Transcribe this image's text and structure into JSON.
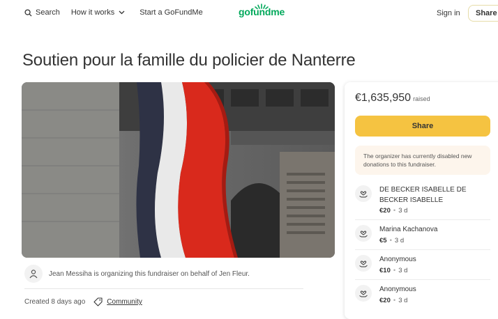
{
  "nav": {
    "search": "Search",
    "how_it_works": "How it works",
    "start": "Start a GoFundMe",
    "logo": "gofundme",
    "sign_in": "Sign in",
    "share": "Share"
  },
  "title": "Soutien pour la famille du policier de Nanterre",
  "organizer": {
    "text": "Jean Messiha is organizing this fundraiser on behalf of Jen Fleur."
  },
  "meta": {
    "created": "Created 8 days ago",
    "category": "Community"
  },
  "panel": {
    "amount": "€1,635,950",
    "raised": "raised",
    "share": "Share",
    "notice": "The organizer has currently disabled new donations to this fundraiser."
  },
  "donations": [
    {
      "name": "DE BECKER ISABELLE DE BECKER ISABELLE",
      "amount": "€20",
      "time": "3 d"
    },
    {
      "name": "Marina Kachanova",
      "amount": "€5",
      "time": "3 d"
    },
    {
      "name": "Anonymous",
      "amount": "€10",
      "time": "3 d"
    },
    {
      "name": "Anonymous",
      "amount": "€20",
      "time": "3 d"
    }
  ],
  "colors": {
    "brand": "#02a95c",
    "accent": "#f5c341"
  }
}
